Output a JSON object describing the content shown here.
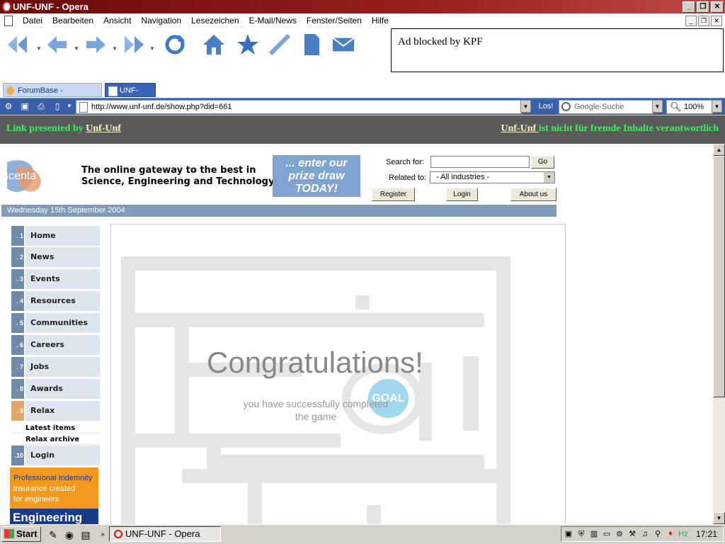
{
  "window": {
    "title": "UNF-UNF - Opera"
  },
  "menu": [
    "Datei",
    "Bearbeiten",
    "Ansicht",
    "Navigation",
    "Lesezeichen",
    "E-Mail/News",
    "Fenster/Seiten",
    "Hilfe"
  ],
  "toolbar": {
    "icons": [
      "rewind-icon",
      "back-icon",
      "forward-icon",
      "fast-forward-icon",
      "reload-icon",
      "home-icon",
      "bookmark-star-icon",
      "pen-icon",
      "new-page-icon",
      "mail-icon"
    ],
    "ad_text": "Ad blocked by KPF"
  },
  "tabs": [
    {
      "label": "ForumBase - Antworten",
      "active": false
    },
    {
      "label": "UNF-UNF",
      "active": true
    }
  ],
  "address": {
    "url": "http://www.unf-unf.de/show.php?did=661",
    "go_label": "Los!",
    "search_placeholder": "Google-Suche",
    "zoom": "100%"
  },
  "presented": {
    "left_text": "Link presented by ",
    "left_link": "Unf-Unf",
    "right_link": "Unf-Unf ",
    "right_text": "ist nicht für fremde Inhalte verantwortlich"
  },
  "site": {
    "logo": "scenta",
    "tagline_1": "The online gateway to the best in",
    "tagline_2": "Science, Engineering and Technology",
    "prize_1": "... enter our",
    "prize_2": "prize draw",
    "prize_3": "TODAY!",
    "search_label": "Search for:",
    "go_button": "Go",
    "related_label": "Related to:",
    "related_value": "- All industries -",
    "register": "Register",
    "login_button": "Login",
    "about": "About us",
    "date": "Wednesday 15th September 2004",
    "nav": [
      {
        "num": ". 1",
        "label": "Home"
      },
      {
        "num": ". 2",
        "label": "News"
      },
      {
        "num": ". 3",
        "label": "Events"
      },
      {
        "num": ". 4",
        "label": "Resources"
      },
      {
        "num": ". 5",
        "label": "Communities"
      },
      {
        "num": ". 6",
        "label": "Careers"
      },
      {
        "num": ". 7",
        "label": "Jobs"
      },
      {
        "num": ". 8",
        "label": "Awards"
      },
      {
        "num": ". 9",
        "label": "Relax",
        "active": true
      }
    ],
    "subnav": [
      "Latest items",
      "Relax archive"
    ],
    "nav_login": {
      "num": ".10",
      "label": "Login"
    },
    "ad_line_1": "Professional Indemnity",
    "ad_line_2": "insurance created",
    "ad_line_3": "for engineers",
    "ad_line_4": "Engineering"
  },
  "game": {
    "title": "Congratulations!",
    "goal": "GOAL",
    "sub_1": "you have successfully completed",
    "sub_2": "the game"
  },
  "taskbar": {
    "start": "Start",
    "task": "UNF-UNF - Opera",
    "clock": "17:21"
  },
  "colors": {
    "accent": "#3a5fa8",
    "presented_text": "#3cf05a",
    "nav_number": "#6e8aa8",
    "nav_active": "#e3a46a"
  }
}
